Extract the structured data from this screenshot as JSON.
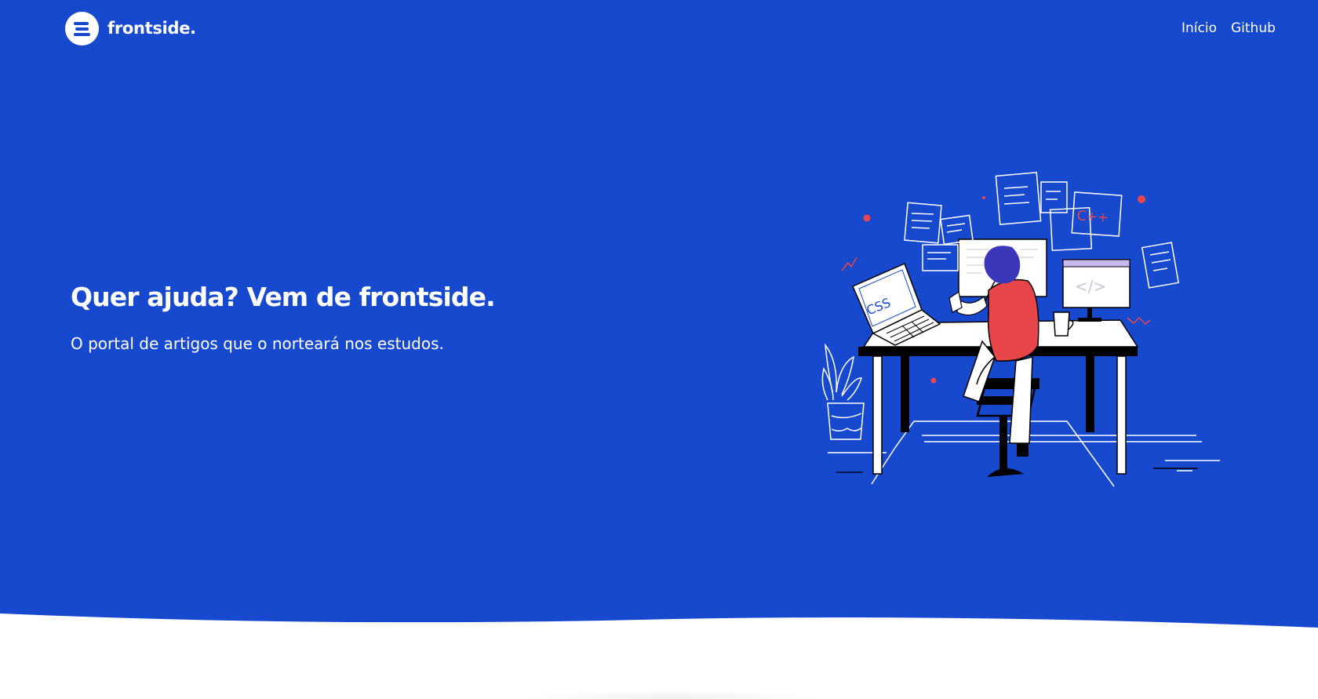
{
  "brand": {
    "name": "frontside.",
    "logo_icon": "menu-lines-logo-icon"
  },
  "nav": {
    "items": [
      {
        "label": "Início"
      },
      {
        "label": "Github"
      }
    ]
  },
  "hero": {
    "title": "Quer ajuda? Vem de frontside.",
    "subtitle": "O portal de artigos que o norteará nos estudos.",
    "illustration": {
      "icon": "developer-at-desk-illustration",
      "laptop_label": "CSS",
      "note_label": "C++",
      "monitor_label": "</>"
    }
  },
  "colors": {
    "hero_background": "#1749cf",
    "accent_red": "#e8464a",
    "text": "#ffffff",
    "page_background": "#ffffff"
  }
}
